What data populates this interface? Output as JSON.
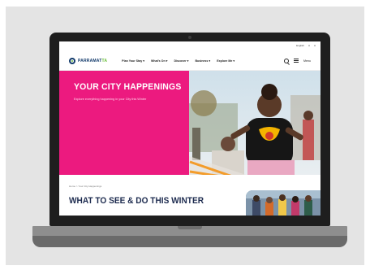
{
  "colors": {
    "hero_pink": "#ec1a7f",
    "brand_navy": "#123a6b",
    "brand_green": "#6bbf3a",
    "title_navy": "#1d2b4f",
    "accent_orange": "#f39c2b"
  },
  "site": {
    "utility_links": [
      "English",
      "A",
      "A"
    ],
    "logo": {
      "text_main": "PARRAMAT",
      "text_accent": "TA"
    },
    "nav": [
      "Plan Your Stay ▾",
      "What's On ▾",
      "Discover ▾",
      "Business ▾",
      "Explore Me ▾"
    ],
    "menu_label": "Menu",
    "hero": {
      "title": "YOUR CITY HAPPENINGS",
      "subtitle": "Explore everything happening in your City this Winter"
    },
    "breadcrumb": "Home  >  Your City Happenings",
    "section_title": "WHAT TO SEE & DO THIS WINTER"
  },
  "icons": {
    "search": "search-icon",
    "menu": "menu-icon",
    "logo": "logo-mark-icon"
  }
}
